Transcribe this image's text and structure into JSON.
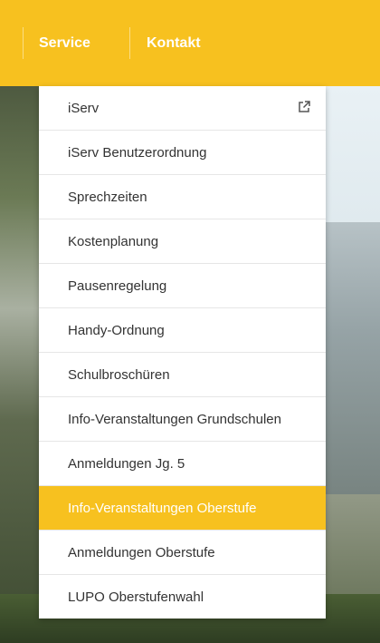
{
  "nav": {
    "items": [
      {
        "label": "Service"
      },
      {
        "label": "Kontakt"
      }
    ]
  },
  "dropdown": {
    "items": [
      {
        "label": "iServ",
        "icon": "external-link-icon"
      },
      {
        "label": "iServ Benutzerordnung"
      },
      {
        "label": "Sprechzeiten"
      },
      {
        "label": "Kostenplanung"
      },
      {
        "label": "Pausenregelung"
      },
      {
        "label": "Handy-Ordnung"
      },
      {
        "label": "Schulbroschüren"
      },
      {
        "label": "Info-Veranstaltungen Grundschulen"
      },
      {
        "label": "Anmeldungen Jg. 5"
      },
      {
        "label": "Info-Veranstaltungen Oberstufe",
        "active": true
      },
      {
        "label": "Anmeldungen Oberstufe"
      },
      {
        "label": "LUPO Oberstufenwahl"
      }
    ]
  },
  "colors": {
    "accent": "#f7c11f",
    "text": "#333333",
    "active_text": "#ffffff"
  }
}
